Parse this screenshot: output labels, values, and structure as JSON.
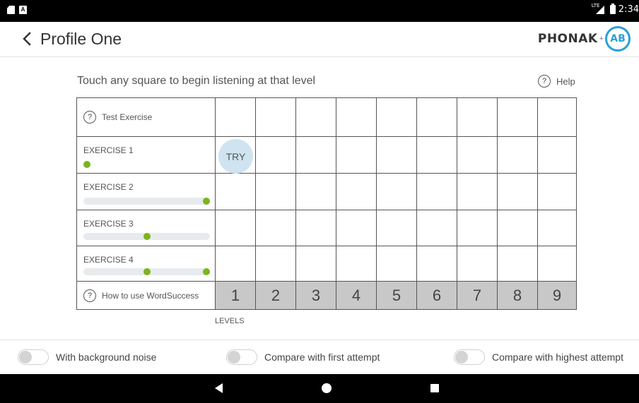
{
  "status_bar": {
    "network_label": "LTE",
    "time": "2:34"
  },
  "header": {
    "title": "Profile One",
    "brand_name": "PHONAK",
    "brand_plus": "+",
    "brand_badge": "AB"
  },
  "instruction": "Touch any square to begin listening at that level",
  "help": {
    "label": "Help",
    "icon_glyph": "?"
  },
  "grid": {
    "rows": [
      {
        "label": "Test Exercise",
        "has_help_icon": true
      },
      {
        "label": "EXERCISE 1",
        "progress_dots": [
          0.0
        ]
      },
      {
        "label": "EXERCISE 2",
        "progress_dots": [
          1.0
        ]
      },
      {
        "label": "EXERCISE 3",
        "progress_dots": [
          0.5
        ]
      },
      {
        "label": "EXERCISE 4",
        "progress_dots": [
          0.5,
          1.0
        ]
      }
    ],
    "try_label": "TRY",
    "how_to_label": "How to use WordSuccess",
    "levels": [
      "1",
      "2",
      "3",
      "4",
      "5",
      "6",
      "7",
      "8",
      "9"
    ],
    "levels_caption": "LEVELS"
  },
  "toggles": [
    {
      "label": "With background noise",
      "on": false
    },
    {
      "label": "Compare with first attempt",
      "on": false
    },
    {
      "label": "Compare with highest attempt",
      "on": false
    }
  ],
  "colors": {
    "accent_green": "#7ab51d",
    "try_bubble": "#cfe4f0",
    "brand_blue": "#2b9fd9",
    "level_cell": "#c8c8c8"
  }
}
